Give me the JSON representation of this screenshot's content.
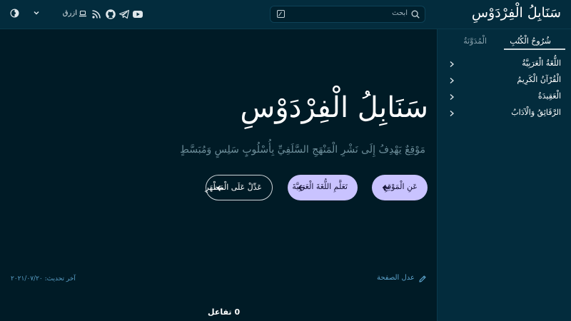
{
  "header": {
    "site_title": "سَنَابِلُ الْفِرْدَوْسِ",
    "search": {
      "placeholder": "ابحث"
    },
    "theme": {
      "label": "ازرق"
    },
    "icons": [
      "youtube-icon",
      "telegram-icon",
      "github-icon",
      "rss-icon"
    ]
  },
  "sidebar": {
    "tabs": [
      {
        "label": "شُرُوحُ الْكُتُبِ",
        "active": true
      },
      {
        "label": "الْمُدَوَّنَةُ",
        "active": false
      }
    ],
    "items": [
      {
        "label": "اللُّغَةُ الْعَرَبِيَّةُ"
      },
      {
        "label": "الْقُرْآنُ الْكَرِيمُ"
      },
      {
        "label": "الْعَقِيدَةُ"
      },
      {
        "label": "الرَّقَائِقُ وَالْآدَابُ"
      }
    ]
  },
  "hero": {
    "title": "سَنَابِلُ الْفِرْدَوْسِ",
    "subtitle": "مَوْقِعٌ يَهْدِفُ إِلَى نَشْرِ الْمَنْهَجِ السَّلَفِيِّ بِأُسْلُوبٍ سَلِسٍ وَمُبَسَّطٍ",
    "buttons": [
      {
        "label": "عَنِ الْمَوْقِعِ",
        "style": "filled"
      },
      {
        "label": "تَعَلَّمِ اللُّغَةَ الْعَرَبِيَّةَ",
        "style": "filled"
      },
      {
        "label": "عَدِّلْ عَلَى الْمَظْهَرِ",
        "style": "outline"
      }
    ]
  },
  "meta": {
    "edit_page": "عدل الصفحة",
    "last_updated": "آخر تحديث: ٢٠٢١/٠٧/٢٠"
  },
  "reactions": {
    "count": "0",
    "label": "تفاعل"
  },
  "colors": {
    "background": "#001b26",
    "panel": "#032c3d",
    "button_fill": "#c9c3ff",
    "link": "#5aa0c8"
  }
}
